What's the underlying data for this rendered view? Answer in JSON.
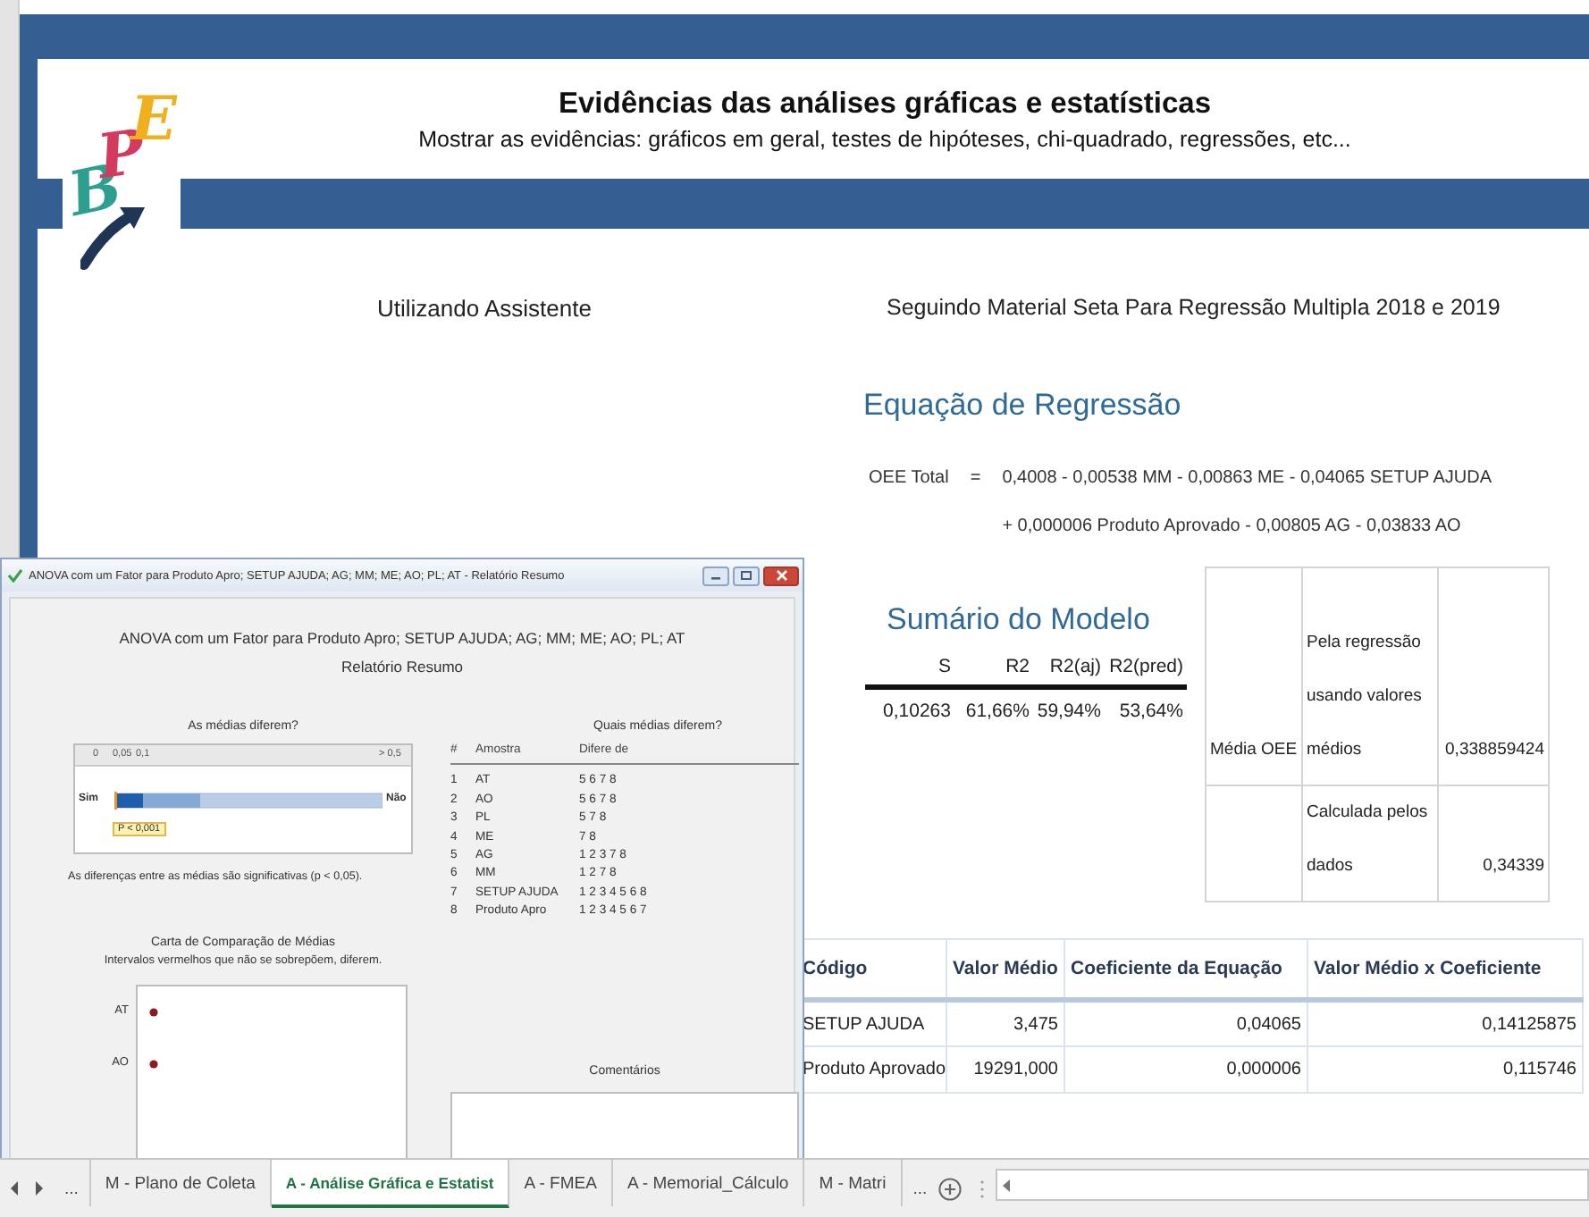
{
  "header": {
    "logo": "BPE",
    "title": "Evidências das análises gráficas e estatísticas",
    "subtitle": "Mostrar as evidências: gráficos em geral, testes de hipóteses, chi-quadrado, regressões, etc..."
  },
  "left_heading": "Utilizando Assistente",
  "right_heading": "Seguindo  Material Seta Para Regressão Multipla 2018 e 2019",
  "regression": {
    "title": "Equação de Regressão",
    "response": "OEE Total",
    "equals": "=",
    "lines": [
      "0,4008 - 0,00538 MM - 0,00863 ME - 0,04065 SETUP AJUDA",
      "+ 0,000006 Produto Aprovado - 0,00805 AG - 0,03833 AO"
    ]
  },
  "model_summary": {
    "title": "Sumário do Modelo",
    "columns": [
      "S",
      "R2",
      "R2(aj)",
      "R2(pred)"
    ],
    "values": [
      "0,10263",
      "61,66%",
      "59,94%",
      "53,64%"
    ]
  },
  "oee_table": {
    "rows": [
      {
        "column_1": "Média OEE",
        "column_2": "Pela regressão usando valores médios",
        "column_3": "0,338859424"
      },
      {
        "column_2": "Calculada pelos dados",
        "column_3": "0,34339"
      }
    ]
  },
  "coefficient_table": {
    "columns": [
      "Código",
      "Valor Médio",
      "Coeficiente da Equação",
      "Valor Médio x Coeficiente"
    ],
    "rows": [
      [
        "SETUP AJUDA",
        "3,475",
        "0,04065",
        "0,14125875"
      ],
      [
        "Produto Aprovado",
        "19291,000",
        "0,000006",
        "0,115746"
      ]
    ]
  },
  "minitab_window": {
    "title": "ANOVA com um Fator para Produto Apro; SETUP AJUDA; AG; MM; ME; AO; PL; AT - Relatório Resumo",
    "report_title": "ANOVA com um Fator para Produto Apro; SETUP AJUDA; AG; MM; ME; AO; PL; AT",
    "report_subtitle": "Relatório Resumo",
    "means_test": {
      "title": "As médias diferem?",
      "ticks": [
        "0",
        "0,05",
        "0,1",
        "> 0,5"
      ],
      "yes_label": "Sim",
      "no_label": "Não",
      "p_value": "P < 0,001",
      "conclusion": "As diferenças entre as médias são significativas (p < 0,05)."
    },
    "comparison_chart": {
      "title": "Carta de Comparação de Médias",
      "subtitle": "Intervalos vermelhos que não se sobrepõem, diferem.",
      "labels": [
        "AT",
        "AO"
      ]
    },
    "differences": {
      "title": "Quais médias diferem?",
      "columns": [
        "#",
        "Amostra",
        "Difere de"
      ],
      "rows": [
        [
          "1",
          "AT",
          "5 6 7 8"
        ],
        [
          "2",
          "AO",
          "5 6 7 8"
        ],
        [
          "3",
          "PL",
          "5 7 8"
        ],
        [
          "4",
          "ME",
          "7 8"
        ],
        [
          "5",
          "AG",
          "1 2 3 7 8"
        ],
        [
          "6",
          "MM",
          "1 2 7 8"
        ],
        [
          "7",
          "SETUP AJUDA",
          "1 2 3 4 5 6 8"
        ],
        [
          "8",
          "Produto Apro",
          "1 2 3 4 5 6 7"
        ]
      ]
    },
    "comments_title": "Comentários"
  },
  "sheet_tabs": {
    "more_left": "...",
    "tabs": [
      {
        "label": "M - Plano de Coleta",
        "selected": false
      },
      {
        "label": "A - Análise Gráfica e Estatist",
        "selected": true
      },
      {
        "label": "A - FMEA",
        "selected": false
      },
      {
        "label": "A - Memorial_Cálculo",
        "selected": false
      },
      {
        "label": "M - Matri",
        "selected": false
      }
    ],
    "more_right": "..."
  }
}
